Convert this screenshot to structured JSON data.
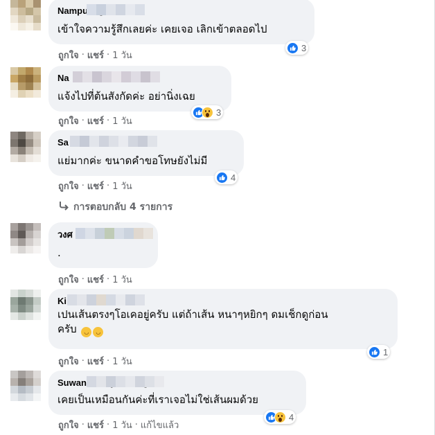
{
  "comments": [
    {
      "name": "Nampueng Naeoo",
      "text": "เข้าใจความรู้สึกเลยค่ะ เคยเจอ เลิกเข้าตลอดไป",
      "reaction_count": "3",
      "reactions": [
        "like"
      ],
      "actions": {
        "like": "ถูกใจ",
        "reply": "แชร์",
        "time": "1 วัน",
        "edited": ""
      }
    },
    {
      "name": "Na",
      "text": "แจ้งไปที่ต้นสังกัดค่ะ อย่านิ่งเฉย",
      "reaction_count": "3",
      "reactions": [
        "like",
        "wow"
      ],
      "actions": {
        "like": "ถูกใจ",
        "reply": "แชร์",
        "time": "1 วัน",
        "edited": ""
      }
    },
    {
      "name": "Sa",
      "text": "แย่มากค่ะ ขนาดคำขอโทษยังไม่มี",
      "reaction_count": "4",
      "reactions": [
        "like"
      ],
      "actions": {
        "like": "ถูกใจ",
        "reply": "แชร์",
        "time": "1 วัน",
        "edited": ""
      }
    },
    {
      "name": "วงศ",
      "text": ".",
      "reaction_count": "",
      "reactions": [],
      "actions": {
        "like": "ถูกใจ",
        "reply": "แชร์",
        "time": "1 วัน",
        "edited": ""
      }
    },
    {
      "name": "Ki",
      "text_line1": "เปนเส้นตรงๆโอเคอยู่ครับ แต่ถ้าเส้น หนาๆหยิกๆ ดมเช็กดูก่อน",
      "text_line2": "ครับ",
      "reaction_count": "1",
      "reactions": [
        "like"
      ],
      "actions": {
        "like": "ถูกใจ",
        "reply": "แชร์",
        "time": "1 วัน",
        "edited": ""
      }
    },
    {
      "name": "Suwanan Wiyonnong",
      "text": "เคยเป็นเหมือนกันค่ะที่เราเจอไม่ใช่เส้นผมด้วย",
      "reaction_count": "4",
      "reactions": [
        "wow"
      ],
      "actions": {
        "like": "ถูกใจ",
        "reply": "แชร์",
        "time": "1 วัน",
        "edited": "แก้ไขแล้ว"
      }
    }
  ],
  "replies_link": "การตอบกลับ 4 รายการ",
  "colors": {
    "bubble": "#f0f2f5",
    "action_text": "#65676b",
    "like_blue": "#1877f2",
    "wow_yellow": "#f7c33b"
  },
  "icons": {
    "like": "thumbs-up-icon",
    "wow": "wow-face-icon",
    "laugh_emoji": "rolling-laughing-emoji",
    "reply_arrow": "reply-arrow-icon"
  }
}
